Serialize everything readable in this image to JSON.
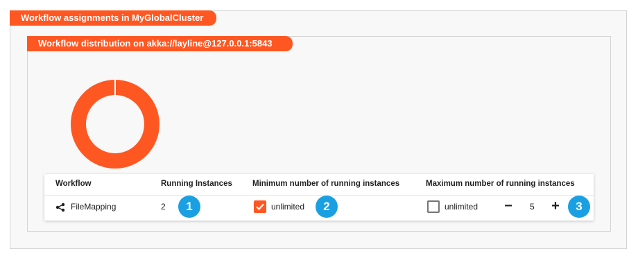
{
  "outer_panel": {
    "title": "Workflow assignments in MyGlobalCluster"
  },
  "inner_panel": {
    "title": "Workflow distribution on akka://layline@127.0.0.1:5843"
  },
  "donut": {
    "color": "#ff5722",
    "segments": [
      {
        "name": "FileMapping",
        "value": 2
      }
    ]
  },
  "table": {
    "headers": {
      "workflow": "Workflow",
      "running": "Running Instances",
      "minimum": "Minimum number of running instances",
      "maximum": "Maximum number of running instances"
    },
    "rows": [
      {
        "workflow": "FileMapping",
        "workflow_icon": "workflow-share-icon",
        "running": "2",
        "minimum": {
          "checked": true,
          "label": "unlimited"
        },
        "maximum": {
          "checked": false,
          "label": "unlimited",
          "decrement": "−",
          "value": "5",
          "increment": "+"
        }
      }
    ]
  },
  "badges": [
    "1",
    "2",
    "3"
  ],
  "colors": {
    "accent": "#ff5722",
    "badge": "#1a9fe3"
  }
}
